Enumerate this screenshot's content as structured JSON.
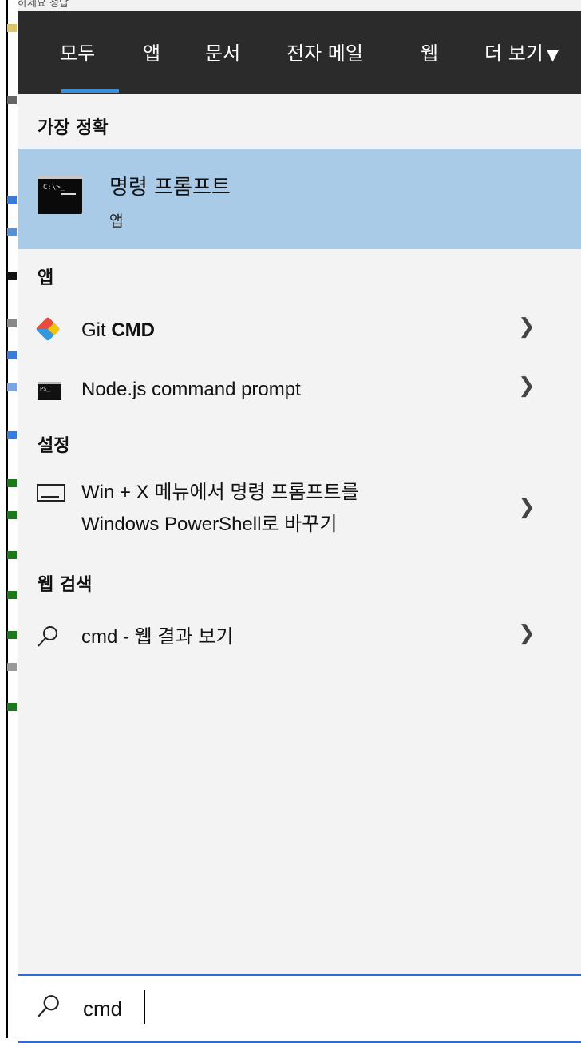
{
  "window": {
    "background_title": "하세요 정답"
  },
  "tabs": [
    {
      "label": "모두",
      "active": true
    },
    {
      "label": "앱"
    },
    {
      "label": "문서"
    },
    {
      "label": "전자 메일"
    },
    {
      "label": "웹"
    },
    {
      "label": "더 보기"
    }
  ],
  "best_match": {
    "heading": "가장 정확",
    "title": "명령 프롬프트",
    "subtitle": "앱"
  },
  "apps": {
    "heading": "앱",
    "items": [
      {
        "label_prefix": "Git ",
        "label_bold": "CMD",
        "icon": "git-icon"
      },
      {
        "label": "Node.js command prompt",
        "icon": "terminal-icon"
      }
    ]
  },
  "settings": {
    "heading": "설정",
    "item_line1": "Win + X 메뉴에서 명령 프롬프트를",
    "item_line2": "Windows PowerShell로 바꾸기"
  },
  "web": {
    "heading": "웹 검색",
    "item": "cmd - 웹 결과 보기"
  },
  "search": {
    "value": "cmd"
  },
  "colors": {
    "accent": "#2d6bd8",
    "tabbar": "#2b2b2b",
    "selection": "#aacbe8"
  }
}
